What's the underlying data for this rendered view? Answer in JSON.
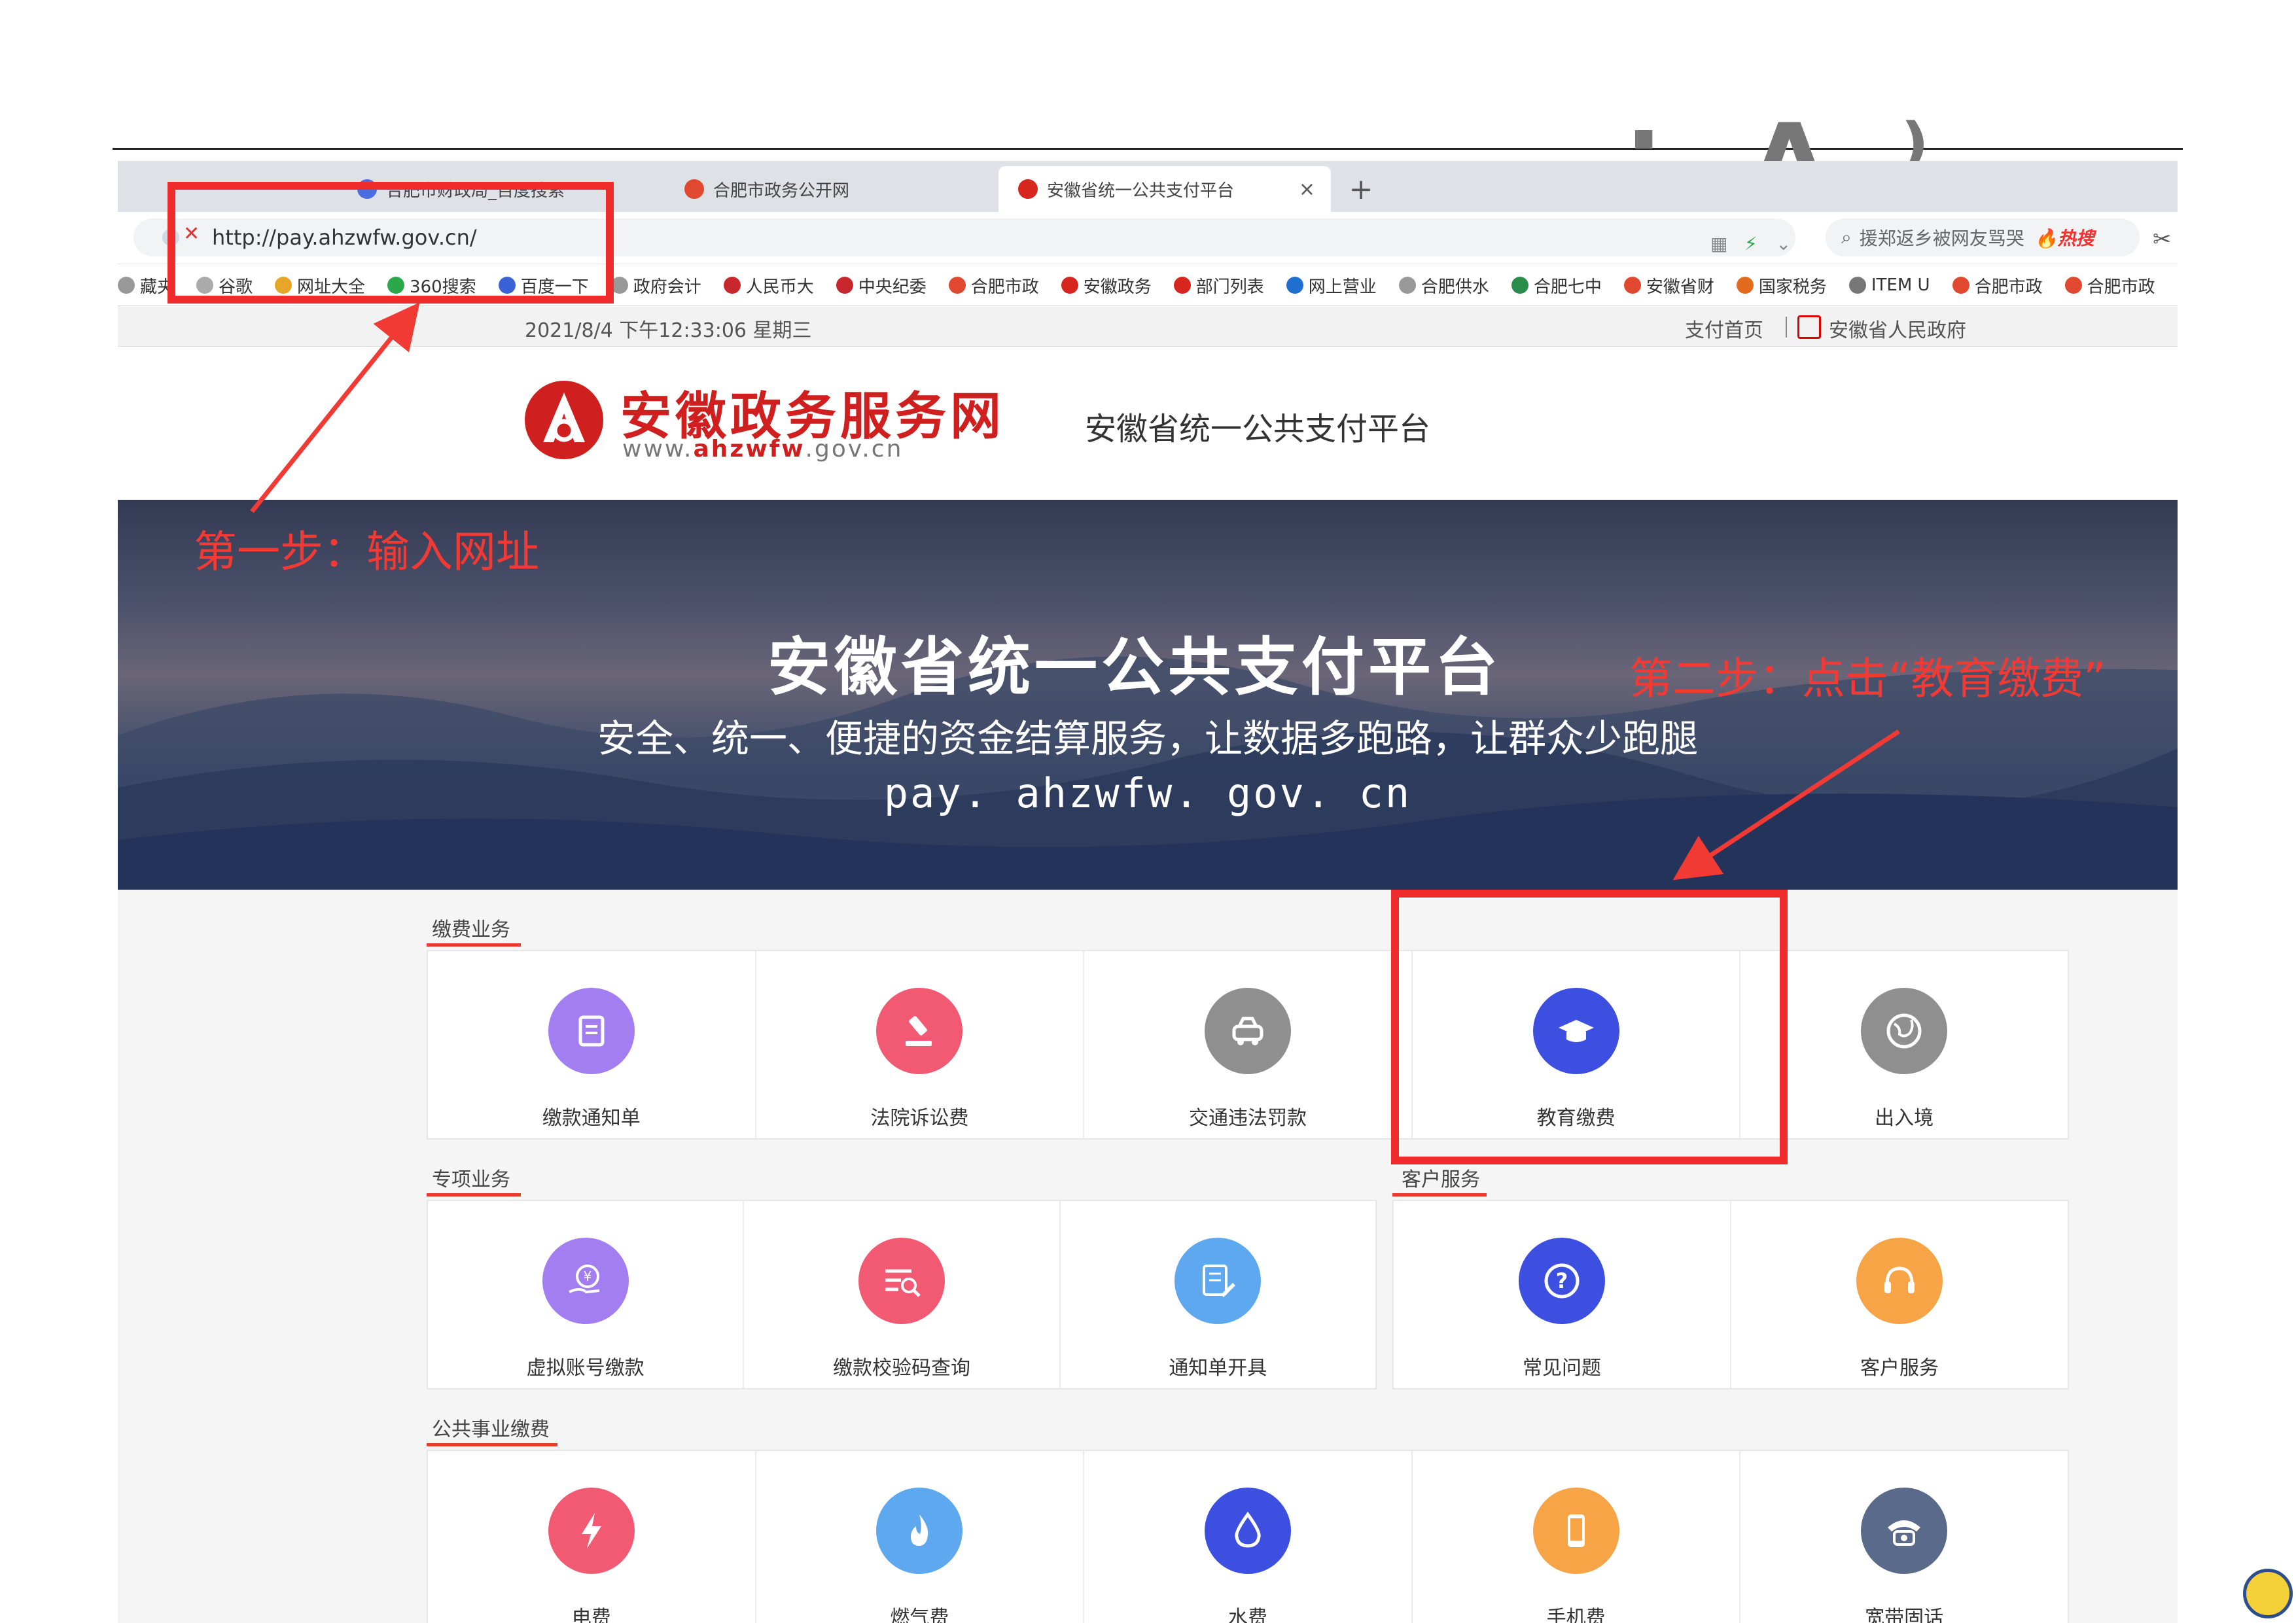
{
  "browser": {
    "tabs": [
      {
        "label": "合肥市财政局_百度搜索",
        "active": false,
        "color": "#4a6ee0"
      },
      {
        "label": "合肥市政务公开网",
        "active": false,
        "color": "#e0492f"
      },
      {
        "label": "安徽省统一公共支付平台",
        "active": true,
        "color": "#d7261e"
      }
    ],
    "close_glyph": "×",
    "newtab_glyph": "+",
    "url": "http://pay.ahzwfw.gov.cn/",
    "search_text": "援郑返乡被网友骂哭",
    "search_hot": "热搜",
    "bookmarks": [
      "藏夹",
      "谷歌",
      "网址大全",
      "360搜索",
      "百度一下",
      "政府会计",
      "人民币大",
      "中央纪委",
      "合肥市政",
      "安徽政务",
      "部门列表",
      "网上营业",
      "合肥供水",
      "合肥七中",
      "安徽省财",
      "国家税务",
      "ITEM U",
      "合肥市政",
      "合肥市政"
    ],
    "bookmark_colors": [
      "#999",
      "#aaa",
      "#e7a52a",
      "#2aa84a",
      "#3a62d6",
      "#999",
      "#c8272d",
      "#c8272d",
      "#e0492f",
      "#d7261e",
      "#d7261e",
      "#1e6fd0",
      "#999",
      "#2a8c4a",
      "#e0492f",
      "#e36b1d",
      "#777",
      "#e0492f",
      "#e0492f"
    ]
  },
  "infobar": {
    "datetime": "2021/8/4 下午12:33:06 星期三",
    "home_link": "支付首页",
    "gov_link": "安徽省人民政府"
  },
  "header": {
    "brand": "安徽政务服务网",
    "url_prefix": "www.",
    "url_bold": "ahzwfw",
    "url_suffix": ".gov.cn",
    "subtitle": "安徽省统一公共支付平台"
  },
  "banner": {
    "title": "安徽省统一公共支付平台",
    "subtitle": "安全、统一、便捷的资金结算服务，让数据多跑路，让群众少跑腿",
    "url": "pay. ahzwfw. gov. cn"
  },
  "sections": {
    "fee": {
      "title": "缴费业务",
      "items": [
        {
          "label": "缴款通知单",
          "color": "#a37ef0",
          "icon": "notice-icon"
        },
        {
          "label": "法院诉讼费",
          "color": "#f25a74",
          "icon": "gavel-icon"
        },
        {
          "label": "交通违法罚款",
          "color": "#8f8f8f",
          "icon": "car-icon"
        },
        {
          "label": "教育缴费",
          "color": "#3c4fe0",
          "icon": "graduation-cap-icon"
        },
        {
          "label": "出入境",
          "color": "#8f8f8f",
          "icon": "globe-icon"
        }
      ]
    },
    "special": {
      "title": "专项业务",
      "items": [
        {
          "label": "虚拟账号缴款",
          "color": "#a37ef0",
          "icon": "yen-hand-icon"
        },
        {
          "label": "缴款校验码查询",
          "color": "#f25a74",
          "icon": "list-search-icon"
        },
        {
          "label": "通知单开具",
          "color": "#5da8ee",
          "icon": "document-edit-icon"
        }
      ]
    },
    "customer": {
      "title": "客户服务",
      "items": [
        {
          "label": "常见问题",
          "color": "#3c4fe0",
          "icon": "question-icon"
        },
        {
          "label": "客户服务",
          "color": "#f7a447",
          "icon": "headset-icon"
        }
      ]
    },
    "public": {
      "title": "公共事业缴费",
      "items": [
        {
          "label": "电费",
          "color": "#f25a74",
          "icon": "lightning-icon"
        },
        {
          "label": "燃气费",
          "color": "#5da8ee",
          "icon": "flame-icon"
        },
        {
          "label": "水费",
          "color": "#3c4fe0",
          "icon": "water-drop-icon"
        },
        {
          "label": "手机费",
          "color": "#f7a447",
          "icon": "phone-icon"
        },
        {
          "label": "宽带固话",
          "color": "#5a6a8a",
          "icon": "telephone-icon"
        }
      ]
    }
  },
  "annotations": {
    "step1": "第一步：输入网址",
    "step2": "第二步：点击“教育缴费”",
    "color": "#f23a35"
  }
}
